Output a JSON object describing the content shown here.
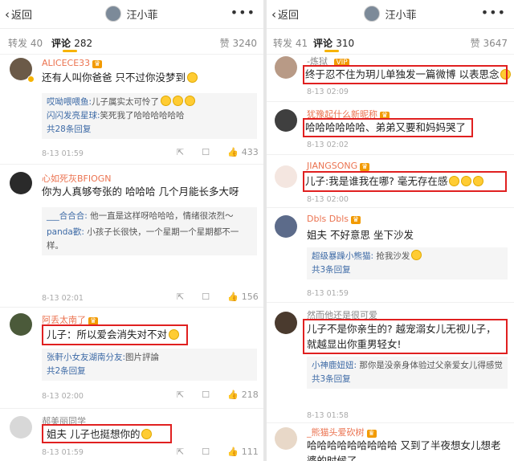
{
  "left": {
    "back_label": "返回",
    "title": "汪小菲",
    "tab_repost": "转发 40",
    "tab_comment": "评论",
    "tab_comment_count": "282",
    "tab_like": "赞 3240",
    "comments": [
      {
        "user": "ALICECE33",
        "text": "还有人叫你爸爸 只不过你没梦到",
        "replies": [
          {
            "name": "哎呦喂喂鱼:",
            "text": "儿子属实太可怜了"
          },
          {
            "name": "闪闪发亮星球:",
            "text": "笑死我了哈哈哈哈哈哈"
          }
        ],
        "more": "共28条回复",
        "time": "8-13 01:59",
        "likes": "433"
      },
      {
        "user": "心如死灰BFIOGN",
        "text": "你为人真够夸张的 哈哈哈 几个月能长多大呀",
        "replies": [
          {
            "name": "___合合合:",
            "text": "他一直是这样呀哈哈哈，情绪很浓烈～"
          },
          {
            "name": "panda歡:",
            "text": "小孩子长很快，一个星期一个星期都不一样。"
          }
        ],
        "more": "",
        "time": "8-13 02:01",
        "likes": "156"
      },
      {
        "user": "阿丢太南了",
        "text": "儿子：所以爱会消失对不对",
        "replies": [
          {
            "name": "张軒小女友湖南分友:",
            "text": "图片評論"
          }
        ],
        "more": "共2条回复",
        "time": "8-13 02:00",
        "likes": "218"
      },
      {
        "user": "郝美丽同学",
        "text": "姐夫 儿子也挺想你的",
        "time": "8-13 01:59",
        "likes": "111"
      }
    ]
  },
  "right": {
    "back_label": "返回",
    "title": "汪小菲",
    "tab_repost": "转发 41",
    "tab_comment": "评论",
    "tab_comment_count": "310",
    "tab_like": "赞 3647",
    "comments": [
      {
        "user": "-炼狱_",
        "text": "终于忍不住为玥儿单独发一篇微博 以表思念",
        "time": "8-13 02:09"
      },
      {
        "user": "犹豫起什么新昵称",
        "text": "哈哈哈哈哈哈、弟弟又要和妈妈哭了",
        "time": "8-13 02:02"
      },
      {
        "user": "JIANGSONG",
        "text": "儿子:我是谁我在哪? 毫无存在感",
        "time": "8-13 02:00"
      },
      {
        "user": "Dbls Dbls",
        "text": "姐夫 不好意思 坐下沙发",
        "replies": [
          {
            "name": "超级暴躁小熊猫:",
            "text": "抢我沙发"
          }
        ],
        "more": "共3条回复",
        "time": "8-13 01:59"
      },
      {
        "user": "然而他还是很可爱",
        "text": "儿子不是你亲生的? 越宠溺女儿无视儿子，就越显出你重男轻女!",
        "replies": [
          {
            "name": "小神鹿妞妞:",
            "text": "那你是没亲身体验过父亲爱女儿得感觉"
          }
        ],
        "more": "共3条回复",
        "time": "8-13 01:58"
      },
      {
        "user": "_熊猫头爱砍树",
        "text": "哈哈哈哈哈哈哈哈哈 又到了半夜想女儿想老婆的时候了"
      }
    ]
  }
}
